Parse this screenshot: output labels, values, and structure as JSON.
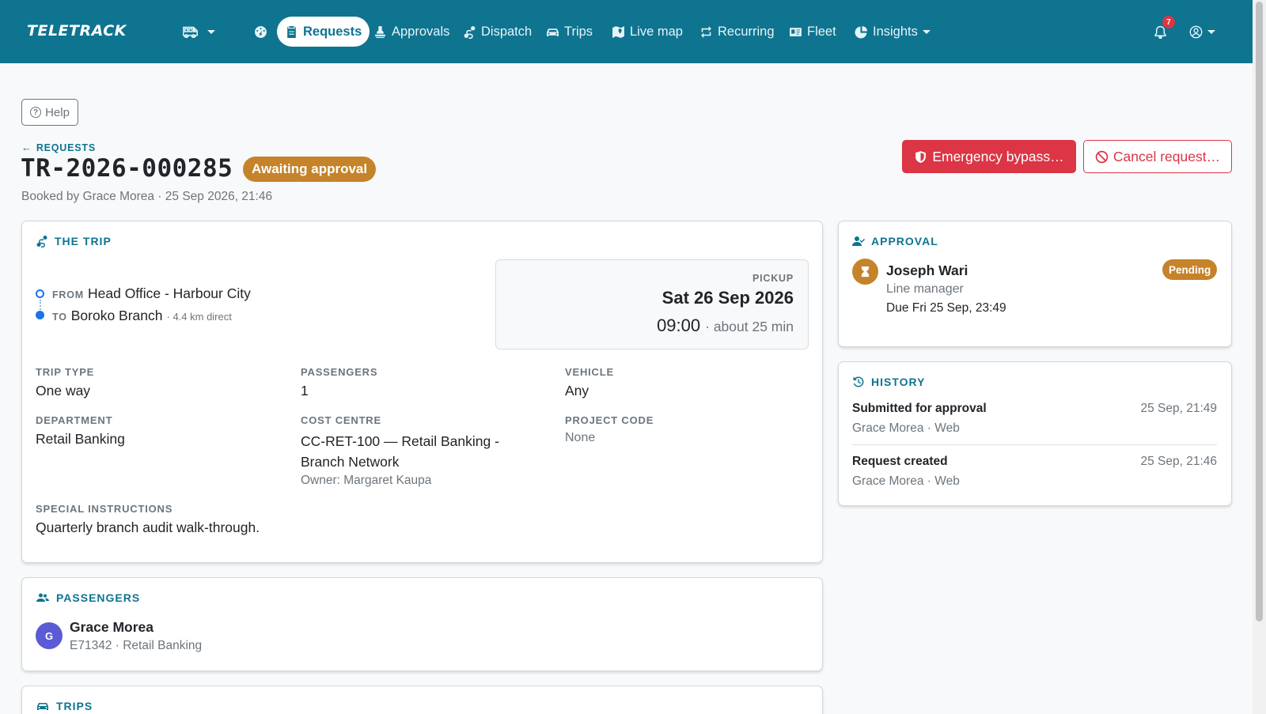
{
  "nav": {
    "brand": "TELETRACK",
    "items": [
      "Requests",
      "Approvals",
      "Dispatch",
      "Trips",
      "Live map",
      "Recurring",
      "Fleet",
      "Insights"
    ],
    "notifications_count": "7"
  },
  "help_label": "Help",
  "header": {
    "back_label": "REQUESTS",
    "request_id": "TR-2026-000285",
    "status": "Awaiting approval",
    "booked_line": "Booked by Grace Morea · 25 Sep 2026, 21:46",
    "emergency_label": "Emergency bypass…",
    "cancel_label": "Cancel request…"
  },
  "trip": {
    "title": "THE TRIP",
    "from_label": "FROM",
    "from": "Head Office - Harbour City",
    "to_label": "TO",
    "to": "Boroko Branch",
    "distance": "· 4.4 km direct",
    "pickup_label": "PICKUP",
    "pickup_date": "Sat 26 Sep 2026",
    "pickup_time": "09:00",
    "pickup_duration": "· about 25 min",
    "fields": {
      "trip_type_label": "TRIP TYPE",
      "trip_type": "One way",
      "passengers_label": "PASSENGERS",
      "passengers": "1",
      "vehicle_label": "VEHICLE",
      "vehicle": "Any",
      "department_label": "DEPARTMENT",
      "department": "Retail Banking",
      "cost_centre_label": "COST CENTRE",
      "cost_centre_line1": "CC-RET-100 — Retail Banking -",
      "cost_centre_line2": "Branch Network",
      "cost_centre_owner": "Owner: Margaret Kaupa",
      "project_code_label": "PROJECT CODE",
      "project_code": "None",
      "instructions_label": "SPECIAL INSTRUCTIONS",
      "instructions": "Quarterly branch audit walk-through."
    }
  },
  "approval": {
    "title": "APPROVAL",
    "approver": "Joseph Wari",
    "role": "Line manager",
    "due": "Due Fri 25 Sep, 23:49",
    "status": "Pending"
  },
  "history": {
    "title": "HISTORY",
    "events": [
      {
        "title": "Submitted for approval",
        "sub": "Grace Morea · Web",
        "time": "25 Sep, 21:49"
      },
      {
        "title": "Request created",
        "sub": "Grace Morea · Web",
        "time": "25 Sep, 21:46"
      }
    ]
  },
  "passengers": {
    "title": "PASSENGERS",
    "list": [
      {
        "initial": "G",
        "name": "Grace Morea",
        "detail": "E71342 · Retail Banking"
      }
    ]
  },
  "trips_section": {
    "title": "TRIPS"
  },
  "colors": {
    "primary": "#0e7490",
    "danger": "#dc3545",
    "warning": "#c5832a",
    "avatar": "#5b5bd6"
  }
}
